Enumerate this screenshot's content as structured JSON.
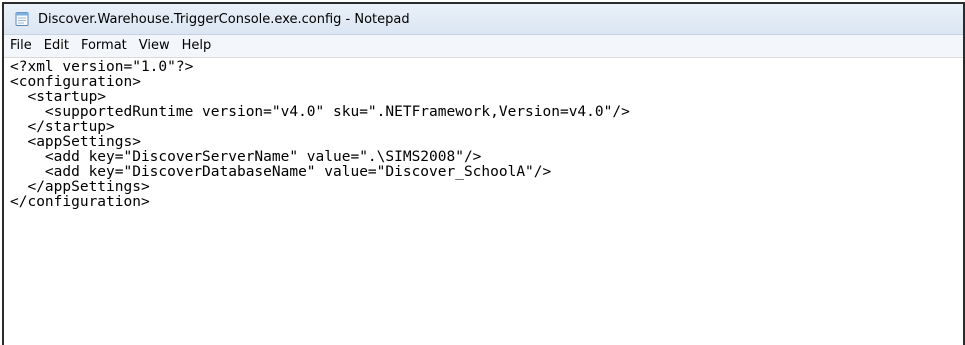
{
  "window": {
    "title": "Discover.Warehouse.TriggerConsole.exe.config - Notepad",
    "icon": "notepad-icon"
  },
  "menu": {
    "items": [
      "File",
      "Edit",
      "Format",
      "View",
      "Help"
    ]
  },
  "editor": {
    "lines": [
      "<?xml version=\"1.0\"?>",
      "<configuration>",
      "  <startup>",
      "    <supportedRuntime version=\"v4.0\" sku=\".NETFramework,Version=v4.0\"/>",
      "  </startup>",
      "  <appSettings>",
      "    <add key=\"DiscoverServerName\" value=\".\\SIMS2008\"/>",
      "    <add key=\"DiscoverDatabaseName\" value=\"Discover_SchoolA\"/>",
      "  </appSettings>",
      "</configuration>"
    ]
  }
}
